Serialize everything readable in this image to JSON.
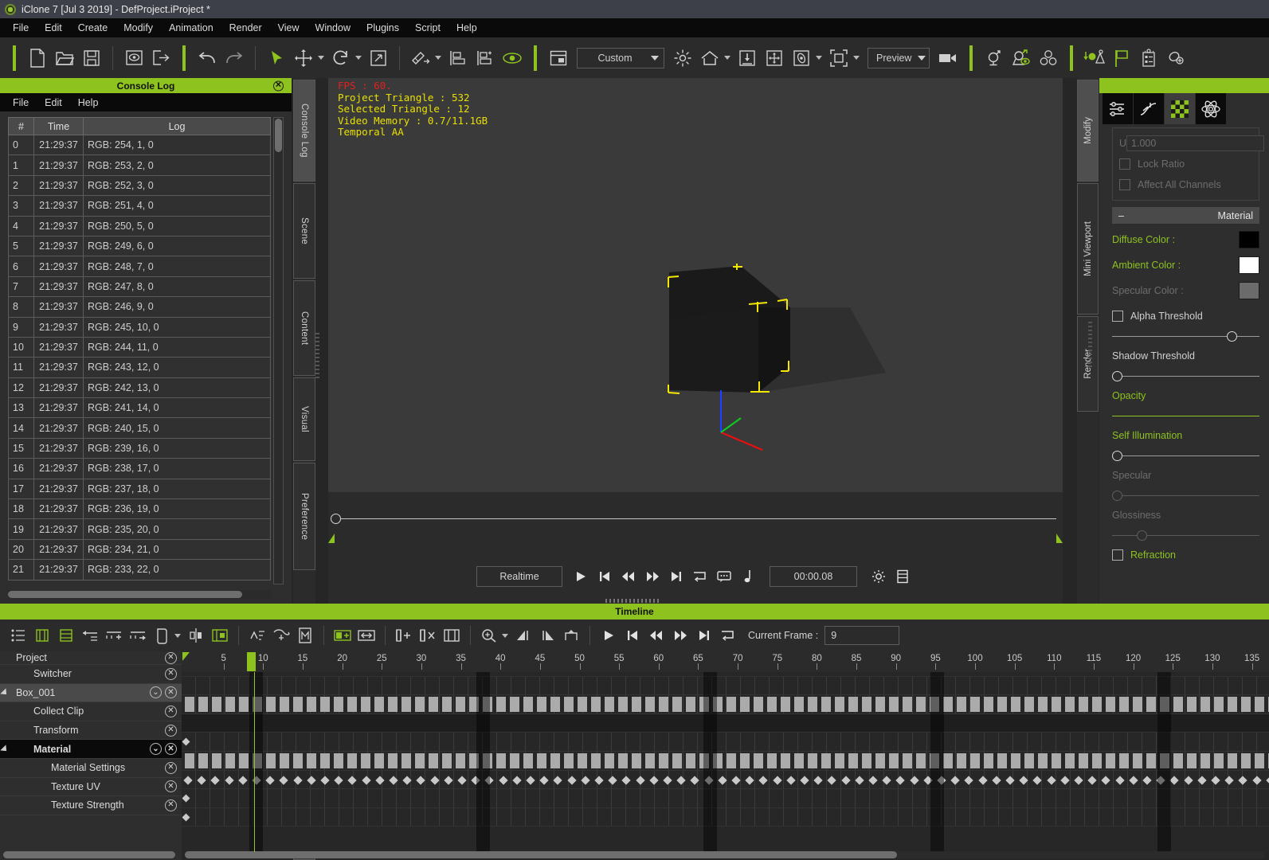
{
  "window": {
    "title": "iClone 7 [Jul  3 2019] - DefProject.iProject *",
    "app_icon": "iclone-logo-icon"
  },
  "menubar": {
    "items": [
      "File",
      "Edit",
      "Create",
      "Modify",
      "Animation",
      "Render",
      "View",
      "Window",
      "Plugins",
      "Script",
      "Help"
    ]
  },
  "toolbar": {
    "viewport_preset": "Custom",
    "render_mode": "Preview",
    "icons": [
      "new-project-icon",
      "open-project-icon",
      "save-project-icon",
      "preview-icon",
      "export-icon",
      "undo-icon",
      "redo-icon",
      "select-tool-icon",
      "move-tool-icon",
      "rotate-tool-icon",
      "scale-tool-icon",
      "attach-icon",
      "align-icon",
      "align-add-icon",
      "eye-visibility-icon",
      "layout-icon",
      "light-icon",
      "home-view-icon",
      "ground-snap-icon",
      "move-viewport-icon",
      "orbit-icon",
      "frame-all-icon",
      "camera-icon",
      "light-tool-icon",
      "look-at-icon",
      "props-icon",
      "drop-to-floor-icon",
      "flag-icon",
      "notes-icon",
      "link-icon"
    ]
  },
  "console": {
    "title": "Console Log",
    "menu": [
      "File",
      "Edit",
      "Help"
    ],
    "columns": [
      "#",
      "Time",
      "Log"
    ],
    "rows": [
      {
        "n": "0",
        "time": "21:29:37",
        "log": "RGB: 254, 1, 0"
      },
      {
        "n": "1",
        "time": "21:29:37",
        "log": "RGB: 253, 2, 0"
      },
      {
        "n": "2",
        "time": "21:29:37",
        "log": "RGB: 252, 3, 0"
      },
      {
        "n": "3",
        "time": "21:29:37",
        "log": "RGB: 251, 4, 0"
      },
      {
        "n": "4",
        "time": "21:29:37",
        "log": "RGB: 250, 5, 0"
      },
      {
        "n": "5",
        "time": "21:29:37",
        "log": "RGB: 249, 6, 0"
      },
      {
        "n": "6",
        "time": "21:29:37",
        "log": "RGB: 248, 7, 0"
      },
      {
        "n": "7",
        "time": "21:29:37",
        "log": "RGB: 247, 8, 0"
      },
      {
        "n": "8",
        "time": "21:29:37",
        "log": "RGB: 246, 9, 0"
      },
      {
        "n": "9",
        "time": "21:29:37",
        "log": "RGB: 245, 10, 0"
      },
      {
        "n": "10",
        "time": "21:29:37",
        "log": "RGB: 244, 11, 0"
      },
      {
        "n": "11",
        "time": "21:29:37",
        "log": "RGB: 243, 12, 0"
      },
      {
        "n": "12",
        "time": "21:29:37",
        "log": "RGB: 242, 13, 0"
      },
      {
        "n": "13",
        "time": "21:29:37",
        "log": "RGB: 241, 14, 0"
      },
      {
        "n": "14",
        "time": "21:29:37",
        "log": "RGB: 240, 15, 0"
      },
      {
        "n": "15",
        "time": "21:29:37",
        "log": "RGB: 239, 16, 0"
      },
      {
        "n": "16",
        "time": "21:29:37",
        "log": "RGB: 238, 17, 0"
      },
      {
        "n": "17",
        "time": "21:29:37",
        "log": "RGB: 237, 18, 0"
      },
      {
        "n": "18",
        "time": "21:29:37",
        "log": "RGB: 236, 19, 0"
      },
      {
        "n": "19",
        "time": "21:29:37",
        "log": "RGB: 235, 20, 0"
      },
      {
        "n": "20",
        "time": "21:29:37",
        "log": "RGB: 234, 21, 0"
      },
      {
        "n": "21",
        "time": "21:29:37",
        "log": "RGB: 233, 22, 0"
      }
    ]
  },
  "left_tabs": [
    "Console Log",
    "Scene",
    "Content",
    "Visual",
    "Preference"
  ],
  "viewport": {
    "stats": {
      "fps": "FPS : 60.",
      "project_triangle": "Project Triangle : 532",
      "selected_triangle": "Selected Triangle : 12",
      "video_memory": "Video Memory : 0.7/11.1GB",
      "aa": "Temporal AA"
    },
    "object": "Box_001"
  },
  "transport": {
    "mode": "Realtime",
    "timecode": "00:00.08",
    "buttons": [
      "play-icon",
      "jump-start-icon",
      "step-back-icon",
      "step-forward-icon",
      "jump-end-icon",
      "loop-icon",
      "speech-icon",
      "note-icon",
      "settings-gear-icon",
      "list-icon"
    ]
  },
  "right_panel": {
    "vtabs": [
      "Modify",
      "Mini Viewport",
      "Render"
    ],
    "tabs": [
      "adjust-sliders-icon",
      "animation-curve-icon",
      "material-checker-icon",
      "physics-atom-icon"
    ],
    "selected_tab": 2,
    "uv": {
      "label": "U",
      "value": "1.000",
      "lock_ratio": "Lock Ratio",
      "affect_all": "Affect All Channels"
    },
    "material_section": "Material",
    "diffuse_label": "Diffuse Color :",
    "diffuse_color": "#000000",
    "ambient_label": "Ambient Color :",
    "ambient_color": "#ffffff",
    "specular_label": "Specular Color :",
    "specular_color": "#6b6b6b",
    "alpha_threshold": "Alpha Threshold",
    "shadow_threshold": "Shadow Threshold",
    "opacity": "Opacity",
    "self_illumination": "Self Illumination",
    "specular": "Specular",
    "glossiness": "Glossiness",
    "refraction": "Refraction"
  },
  "timeline": {
    "title": "Timeline",
    "current_frame_label": "Current Frame :",
    "current_frame": "9",
    "ruler_labels": [
      "5",
      "10",
      "15",
      "20",
      "25",
      "30",
      "35",
      "40",
      "45",
      "50",
      "55",
      "60",
      "65",
      "70",
      "75",
      "80",
      "85",
      "90",
      "95",
      "100",
      "105",
      "110",
      "115",
      "120",
      "125",
      "130",
      "135"
    ],
    "tracks": [
      {
        "name": "Project",
        "level": 0,
        "partial": true,
        "expand": null,
        "selected": false
      },
      {
        "name": "Switcher",
        "level": 1,
        "expand": null,
        "selected": false
      },
      {
        "name": "Box_001",
        "level": 0,
        "expand": "down",
        "selected": true
      },
      {
        "name": "Collect Clip",
        "level": 1,
        "expand": null,
        "selected": false
      },
      {
        "name": "Transform",
        "level": 1,
        "expand": null,
        "selected": false
      },
      {
        "name": "Material",
        "level": 1,
        "expand": "down",
        "selected": "black"
      },
      {
        "name": "Material Settings",
        "level": 2,
        "expand": null,
        "selected": false
      },
      {
        "name": "Texture UV",
        "level": 2,
        "expand": null,
        "selected": false
      },
      {
        "name": "Texture Strength",
        "level": 2,
        "expand": null,
        "selected": false
      }
    ]
  },
  "colors": {
    "accent_green": "#8dc21f",
    "panel_bg": "#2e2e2e",
    "toolbar_bg": "#2b2b2b",
    "viewport_bg": "#3a3a3a",
    "stat_red": "#e02020",
    "stat_yellow": "#e8e000"
  }
}
